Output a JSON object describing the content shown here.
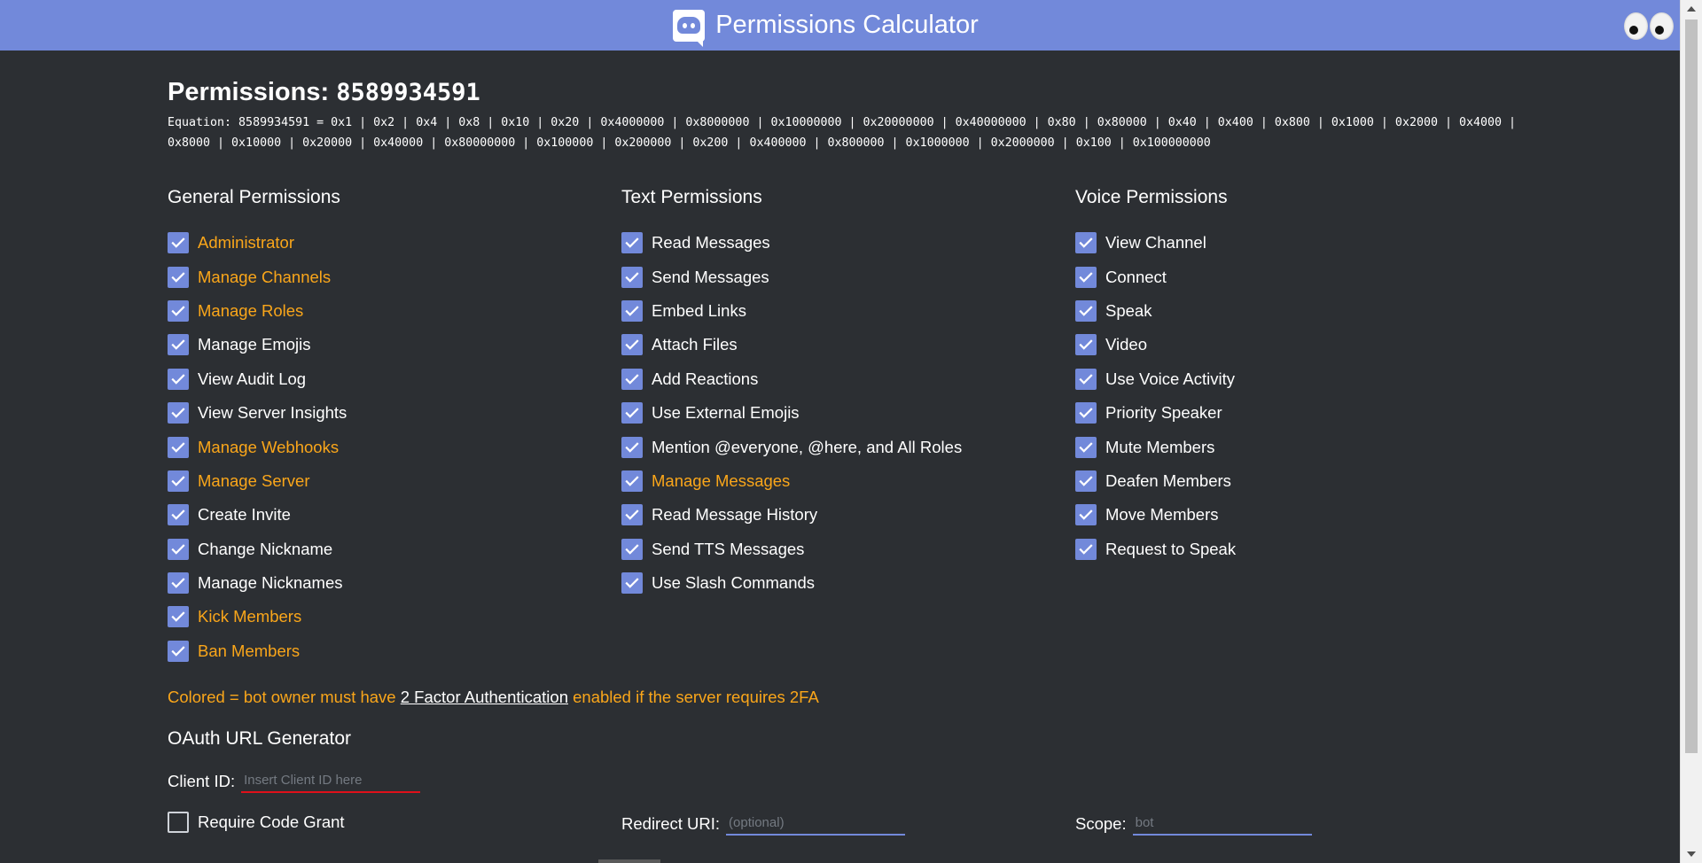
{
  "header": {
    "title": "Permissions Calculator",
    "logo_icon": "discord-logo-icon",
    "eyes_icon": "googly-eyes-icon"
  },
  "permissions": {
    "label": "Permissions:",
    "value": "8589934591",
    "equation": "Equation: 8589934591 = 0x1 | 0x2 | 0x4 | 0x8 | 0x10 | 0x20 | 0x4000000 | 0x8000000 | 0x10000000 | 0x20000000 | 0x40000000 | 0x80 | 0x80000 | 0x40 | 0x400 | 0x800 | 0x1000 | 0x2000 | 0x4000 | 0x8000 | 0x10000 | 0x20000 | 0x40000 | 0x80000000 | 0x100000 | 0x200000 | 0x200 | 0x400000 | 0x800000 | 0x1000000 | 0x2000000 | 0x100 | 0x100000000"
  },
  "columns": {
    "general": {
      "heading": "General Permissions",
      "items": [
        {
          "label": "Administrator",
          "colored": true,
          "checked": true
        },
        {
          "label": "Manage Channels",
          "colored": true,
          "checked": true
        },
        {
          "label": "Manage Roles",
          "colored": true,
          "checked": true
        },
        {
          "label": "Manage Emojis",
          "colored": false,
          "checked": true
        },
        {
          "label": "View Audit Log",
          "colored": false,
          "checked": true
        },
        {
          "label": "View Server Insights",
          "colored": false,
          "checked": true
        },
        {
          "label": "Manage Webhooks",
          "colored": true,
          "checked": true
        },
        {
          "label": "Manage Server",
          "colored": true,
          "checked": true
        },
        {
          "label": "Create Invite",
          "colored": false,
          "checked": true
        },
        {
          "label": "Change Nickname",
          "colored": false,
          "checked": true
        },
        {
          "label": "Manage Nicknames",
          "colored": false,
          "checked": true
        },
        {
          "label": "Kick Members",
          "colored": true,
          "checked": true
        },
        {
          "label": "Ban Members",
          "colored": true,
          "checked": true
        }
      ]
    },
    "text": {
      "heading": "Text Permissions",
      "items": [
        {
          "label": "Read Messages",
          "colored": false,
          "checked": true
        },
        {
          "label": "Send Messages",
          "colored": false,
          "checked": true
        },
        {
          "label": "Embed Links",
          "colored": false,
          "checked": true
        },
        {
          "label": "Attach Files",
          "colored": false,
          "checked": true
        },
        {
          "label": "Add Reactions",
          "colored": false,
          "checked": true
        },
        {
          "label": "Use External Emojis",
          "colored": false,
          "checked": true
        },
        {
          "label": "Mention @everyone, @here, and All Roles",
          "colored": false,
          "checked": true
        },
        {
          "label": "Manage Messages",
          "colored": true,
          "checked": true
        },
        {
          "label": "Read Message History",
          "colored": false,
          "checked": true
        },
        {
          "label": "Send TTS Messages",
          "colored": false,
          "checked": true
        },
        {
          "label": "Use Slash Commands",
          "colored": false,
          "checked": true
        }
      ]
    },
    "voice": {
      "heading": "Voice Permissions",
      "items": [
        {
          "label": "View Channel",
          "colored": false,
          "checked": true
        },
        {
          "label": "Connect",
          "colored": false,
          "checked": true
        },
        {
          "label": "Speak",
          "colored": false,
          "checked": true
        },
        {
          "label": "Video",
          "colored": false,
          "checked": true
        },
        {
          "label": "Use Voice Activity",
          "colored": false,
          "checked": true
        },
        {
          "label": "Priority Speaker",
          "colored": false,
          "checked": true
        },
        {
          "label": "Mute Members",
          "colored": false,
          "checked": true
        },
        {
          "label": "Deafen Members",
          "colored": false,
          "checked": true
        },
        {
          "label": "Move Members",
          "colored": false,
          "checked": true
        },
        {
          "label": "Request to Speak",
          "colored": false,
          "checked": true
        }
      ]
    }
  },
  "note": {
    "prefix": "Colored = bot owner must have ",
    "link": "2 Factor Authentication",
    "suffix": " enabled if the server requires 2FA"
  },
  "oauth": {
    "title": "OAuth URL Generator",
    "client_id_label": "Client ID:",
    "client_id_placeholder": "Insert Client ID here",
    "client_id_value": "",
    "code_grant_label": "Require Code Grant",
    "code_grant_checked": false,
    "redirect_label": "Redirect URI:",
    "redirect_placeholder": "(optional)",
    "redirect_value": "",
    "scope_label": "Scope:",
    "scope_placeholder": "bot",
    "scope_value": ""
  },
  "colors": {
    "header_bg": "#7289da",
    "page_bg": "#2c2f33",
    "colored_text": "#faa61a",
    "checkbox": "#7289da",
    "error_underline": "#e0101a"
  }
}
